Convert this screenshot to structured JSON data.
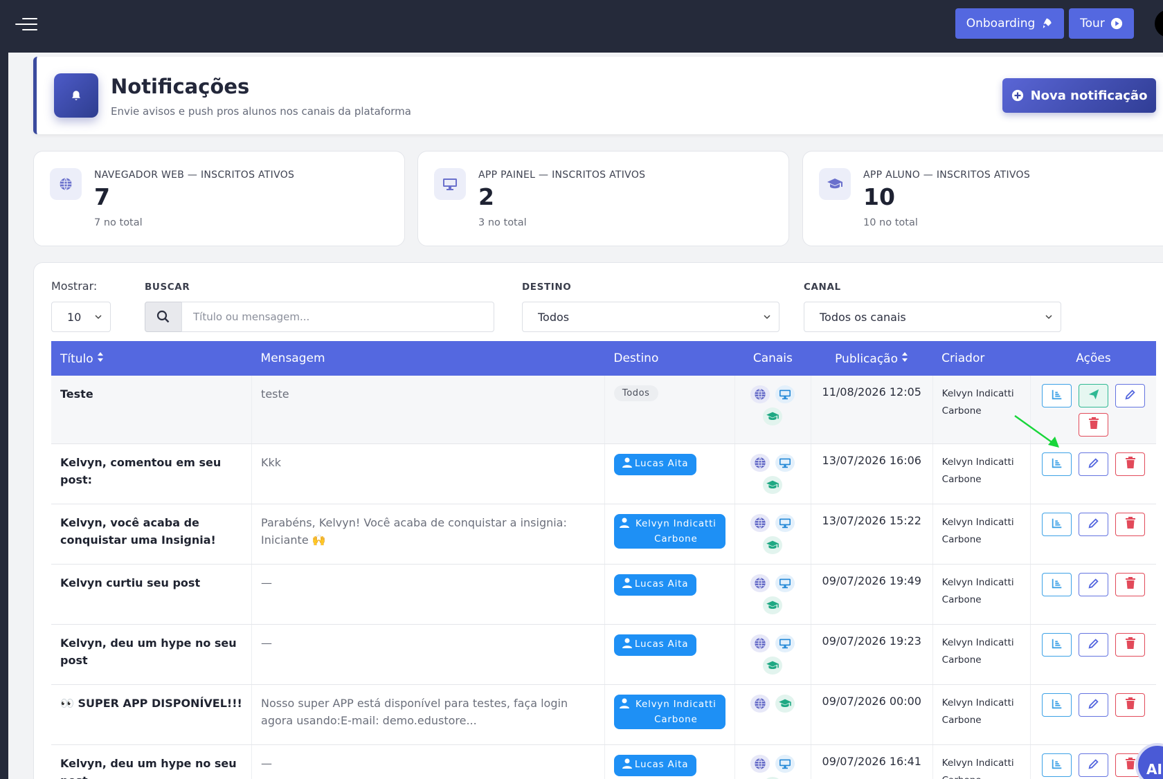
{
  "topbar": {
    "onboarding_label": "Onboarding",
    "tour_label": "Tour"
  },
  "header": {
    "title": "Notificações",
    "subtitle": "Envie avisos e push pros alunos nos canais da plataforma",
    "new_button_label": "Nova notificação"
  },
  "stats": [
    {
      "label": "NAVEGADOR WEB — INSCRITOS ATIVOS",
      "value": "7",
      "total": "7 no total",
      "icon": "globe-icon"
    },
    {
      "label": "APP PAINEL — INSCRITOS ATIVOS",
      "value": "2",
      "total": "3 no total",
      "icon": "monitor-icon"
    },
    {
      "label": "APP ALUNO — INSCRITOS ATIVOS",
      "value": "10",
      "total": "10 no total",
      "icon": "graduation-cap-icon"
    }
  ],
  "filters": {
    "show_label": "Mostrar:",
    "show_value": "10",
    "search_label": "BUSCAR",
    "search_placeholder": "Título ou mensagem...",
    "destino_label": "DESTINO",
    "destino_value": "Todos",
    "canal_label": "CANAL",
    "canal_value": "Todos os canais"
  },
  "table": {
    "headers": {
      "titulo": "Título",
      "mensagem": "Mensagem",
      "destino": "Destino",
      "canais": "Canais",
      "publicacao": "Publicação",
      "criador": "Criador",
      "acoes": "Ações"
    },
    "rows": [
      {
        "title": "Teste",
        "message": "teste",
        "destino": "Todos",
        "publicacao": "11/08/2026 12:05",
        "creator": "Kelvyn Indicatti Carbone"
      },
      {
        "title": "Kelvyn, comentou em seu post:",
        "message": "Kkk",
        "destino": "Lucas Aita",
        "publicacao": "13/07/2026 16:06",
        "creator": "Kelvyn Indicatti Carbone"
      },
      {
        "title": "Kelvyn, você acaba de conquistar uma Insignia!",
        "message": "Parabéns, Kelvyn! Você acaba de conquistar a insignia: Iniciante 🙌",
        "destino": "Kelvyn Indicatti Carbone",
        "publicacao": "13/07/2026 15:22",
        "creator": "Kelvyn Indicatti Carbone"
      },
      {
        "title": "Kelvyn curtiu seu post",
        "message": "—",
        "destino": "Lucas Aita",
        "publicacao": "09/07/2026 19:49",
        "creator": "Kelvyn Indicatti Carbone"
      },
      {
        "title": "Kelvyn, deu um hype no seu post",
        "message": "—",
        "destino": "Lucas Aita",
        "publicacao": "09/07/2026 19:23",
        "creator": "Kelvyn Indicatti Carbone"
      },
      {
        "title": "👀 SUPER APP DISPONÍVEL!!!",
        "message": "Nosso super APP está disponível para testes, faça login agora usando:E-mail: demo.edustore...",
        "destino": "Kelvyn Indicatti Carbone",
        "publicacao": "09/07/2026 00:00",
        "creator": "Kelvyn Indicatti Carbone"
      },
      {
        "title": "Kelvyn, deu um hype no seu post",
        "message": "—",
        "destino": "Lucas Aita",
        "publicacao": "09/07/2026 16:41",
        "creator": "Kelvyn Indicatti Carbone"
      }
    ]
  },
  "fab_label": "AI",
  "colors": {
    "topbar": "#252a3a",
    "accent": "#5468e0",
    "badge_user": "#1e90f5",
    "delete": "#e24a5a",
    "send": "#2fb893"
  }
}
